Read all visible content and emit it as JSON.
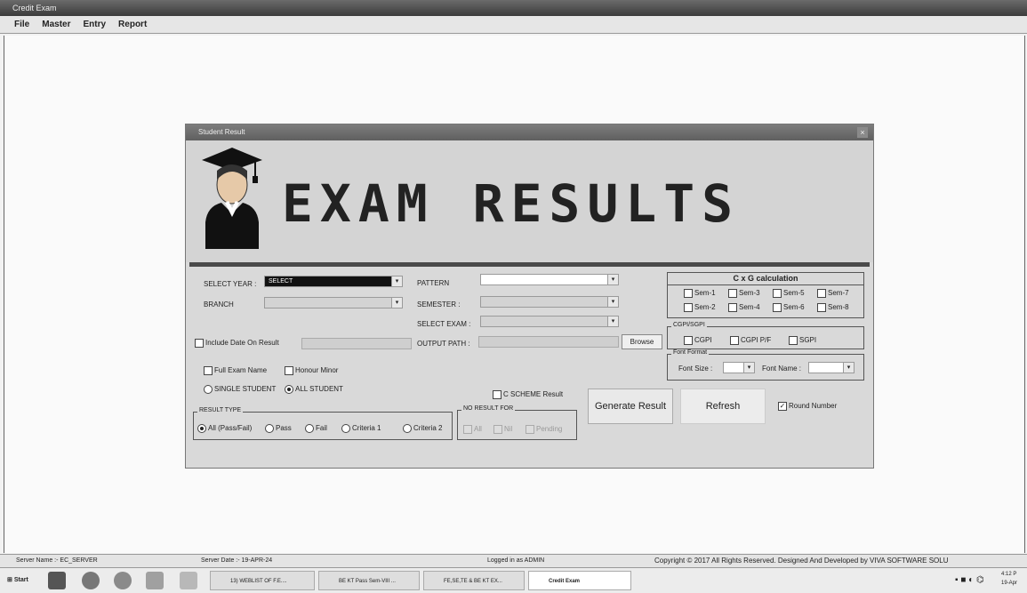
{
  "app": {
    "title": "Credit Exam"
  },
  "menu": [
    "File",
    "Master",
    "Entry",
    "Report"
  ],
  "window": {
    "title": "Student Result",
    "close_glyph": "×",
    "banner_title": "EXAM  RESULTS"
  },
  "form": {
    "select_year_label": "SELECT YEAR :",
    "select_year_value": "SELECT",
    "branch_label": "BRANCH",
    "pattern_label": "PATTERN",
    "semester_label": "SEMESTER :",
    "select_exam_label": "SELECT EXAM :",
    "output_path_label": "OUTPUT PATH :",
    "browse_label": "Browse",
    "include_date_label": "Include Date On Result",
    "full_exam_name_label": "Full Exam Name",
    "honour_minor_label": "Honour Minor",
    "single_student_label": "SINGLE STUDENT",
    "all_student_label": "ALL STUDENT",
    "c_scheme_label": "C SCHEME Result",
    "result_type": {
      "title": "RESULT TYPE",
      "options": [
        "All (Pass/Fail)",
        "Pass",
        "Fail",
        "Criteria 1",
        "Criteria 2"
      ]
    },
    "no_result_for": {
      "title": "NO RESULT FOR",
      "options": [
        "All",
        "Nil",
        "Pending"
      ]
    },
    "generate_label": "Generate Result",
    "refresh_label": "Refresh",
    "round_number_label": "Round Number",
    "cxg": {
      "title": "C x G calculation",
      "sems": [
        "Sem-1",
        "Sem-3",
        "Sem-5",
        "Sem-7",
        "Sem-2",
        "Sem-4",
        "Sem-6",
        "Sem-8"
      ]
    },
    "cgpi": {
      "title": "CGPI/SGPI",
      "options": [
        "CGPI",
        "CGPI P/F",
        "SGPI"
      ]
    },
    "font_format": {
      "title": "Font Format",
      "size_label": "Font Size :",
      "name_label": "Font Name :"
    }
  },
  "status": {
    "server_name": "Server Name :- EC_SERVER",
    "server_date": "Server Date :- 19-APR-24",
    "logged_in": "Logged in as ADMIN",
    "copyright": "Copyright © 2017 All Rights Reserved. Designed And Developed by VIVA SOFTWARE SOLU"
  },
  "taskbar": {
    "start": "Start",
    "buttons": [
      "13) WEBLIST OF F.E....",
      "BE KT Pass Sem-VIII ...",
      "FE,SE,TE & BE KT EX...",
      "Credit Exam"
    ],
    "clock_time": "4:12 P",
    "clock_date": "19-Apr"
  }
}
